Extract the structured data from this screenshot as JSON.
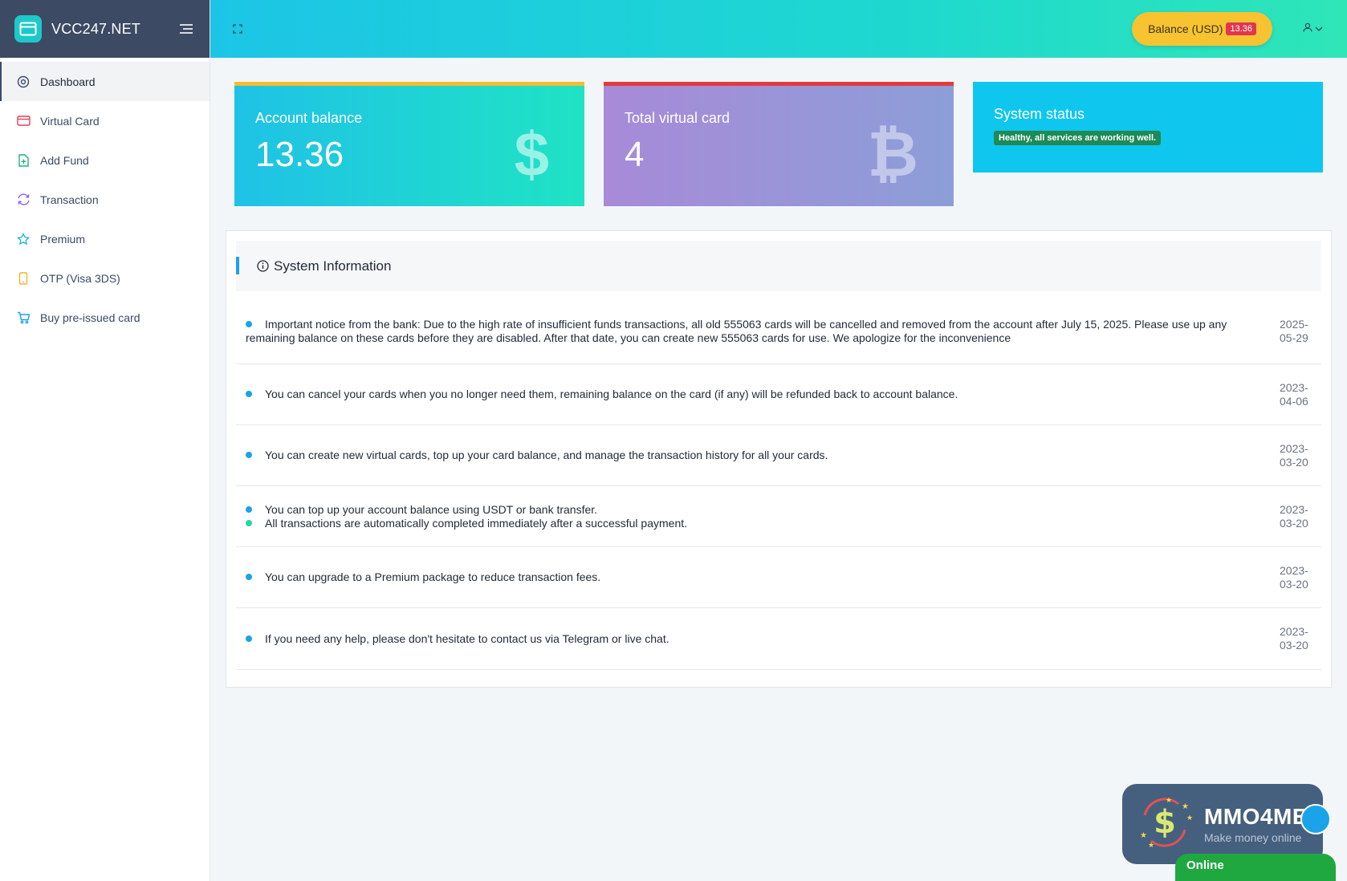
{
  "brand": {
    "name": "VCC247.NET"
  },
  "sidebar": {
    "items": [
      {
        "label": "Dashboard",
        "active": true
      },
      {
        "label": "Virtual Card"
      },
      {
        "label": "Add Fund"
      },
      {
        "label": "Transaction"
      },
      {
        "label": "Premium"
      },
      {
        "label": "OTP (Visa 3DS)"
      },
      {
        "label": "Buy pre-issued card"
      }
    ]
  },
  "header": {
    "balance_label": "Balance (USD)",
    "balance_value": "13.36"
  },
  "cards": {
    "account_balance": {
      "label": "Account balance",
      "value": "13.36",
      "icon": "$"
    },
    "total_virtual_card": {
      "label": "Total virtual card",
      "value": "4",
      "icon": "₿"
    },
    "system_status": {
      "label": "System status",
      "badge": "Healthy, all services are working well."
    }
  },
  "system_info": {
    "title": "System Information",
    "items": [
      {
        "text": "Important notice from the bank: Due to the high rate of insufficient funds transactions, all old 555063 cards will be cancelled and removed from the account after July 15, 2025. Please use up any remaining balance on these cards before they are disabled. After that date, you can create new 555063 cards for use. We apologize for the inconvenience",
        "date": "2025-05-29"
      },
      {
        "text": "You can cancel your cards when you no longer need them, remaining balance on the card (if any) will be refunded back to account balance.",
        "date": "2023-04-06"
      },
      {
        "text": "You can create new virtual cards, top up your card balance, and manage the transaction history for all your cards.",
        "date": "2023-03-20"
      },
      {
        "text": "You can top up your account balance using USDT or bank transfer.",
        "text2": "All transactions are automatically completed immediately after a successful payment.",
        "date": "2023-03-20"
      },
      {
        "text": "You can upgrade to a Premium package to reduce transaction fees.",
        "date": "2023-03-20"
      },
      {
        "text": "If you need any help, please don't hesitate to contact us via Telegram or live chat.",
        "date": "2023-03-20"
      }
    ]
  },
  "watermark": {
    "title": "MMO4ME",
    "subtitle": "Make money online"
  },
  "chat": {
    "label": "Online"
  },
  "colors": {
    "header_start": "#1cc5e6",
    "header_end": "#2ee6b8",
    "brand_bg": "#3c4a63",
    "balance_pill": "#f7c330",
    "badge_red": "#e0364f",
    "status_green": "#1d8a57"
  }
}
